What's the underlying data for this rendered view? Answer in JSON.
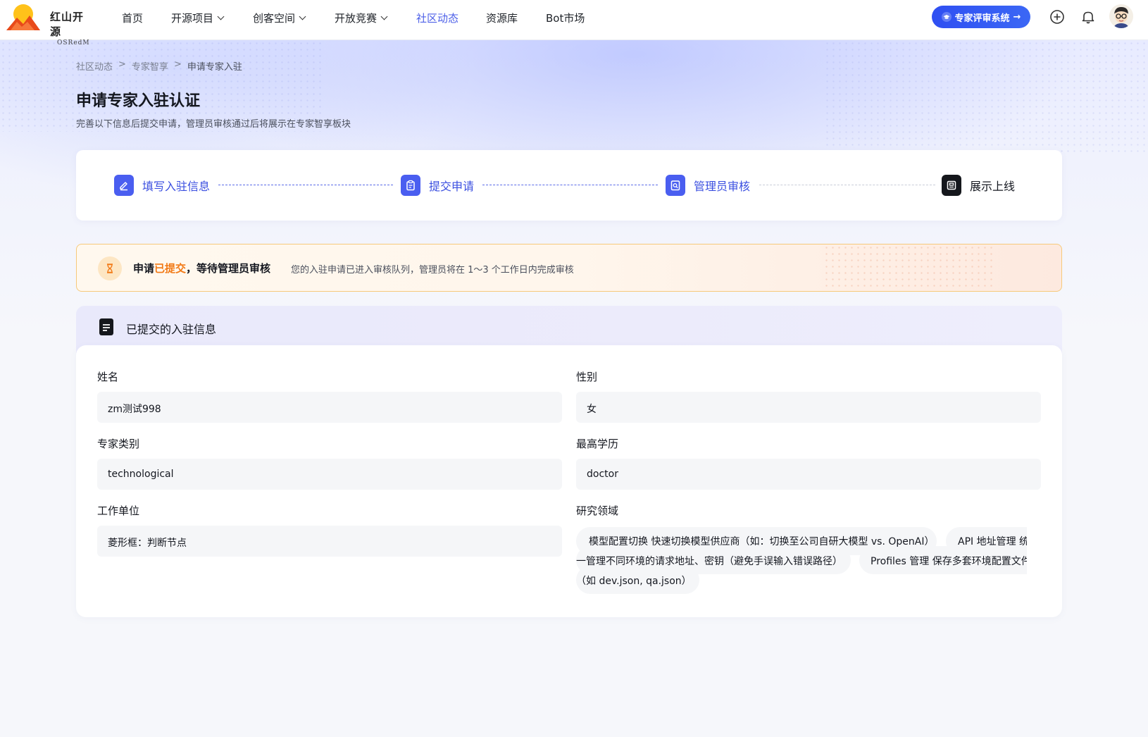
{
  "header": {
    "logo_cn": "红山开源",
    "logo_en": "OSRedM",
    "nav": [
      {
        "label": "首页",
        "dropdown": false
      },
      {
        "label": "开源项目",
        "dropdown": true
      },
      {
        "label": "创客空间",
        "dropdown": true
      },
      {
        "label": "开放竞赛",
        "dropdown": true
      },
      {
        "label": "社区动态",
        "dropdown": false,
        "active": true
      },
      {
        "label": "资源库",
        "dropdown": false
      },
      {
        "label": "Bot市场",
        "dropdown": false
      }
    ],
    "expert_button": "专家评审系统",
    "icons": [
      "plus-circle-icon",
      "bell-icon",
      "avatar"
    ]
  },
  "breadcrumb": [
    "社区动态",
    "专家智享",
    "申请专家入驻"
  ],
  "page": {
    "title": "申请专家入驻认证",
    "subtitle": "完善以下信息后提交申请，管理员审核通过后将展示在专家智享板块"
  },
  "steps": [
    {
      "label": "填写入驻信息",
      "icon": "edit-icon",
      "state": "done"
    },
    {
      "label": "提交申请",
      "icon": "clipboard-icon",
      "state": "done"
    },
    {
      "label": "管理员审核",
      "icon": "review-icon",
      "state": "current"
    },
    {
      "label": "展示上线",
      "icon": "display-icon",
      "state": "pending"
    }
  ],
  "notice": {
    "icon": "hourglass-icon",
    "title_prefix": "申请",
    "title_highlight": "已提交",
    "title_suffix": "，等待管理员审核",
    "description": "您的入驻申请已进入审核队列，管理员将在 1～3 个工作日内完成审核",
    "accent": "#f27a16"
  },
  "info": {
    "section_title": "已提交的入驻信息",
    "fields": {
      "name": {
        "label": "姓名",
        "value": "zm测试998"
      },
      "gender": {
        "label": "性别",
        "value": "女"
      },
      "category": {
        "label": "专家类别",
        "value": "technological"
      },
      "education": {
        "label": "最高学历",
        "value": "doctor"
      },
      "organization": {
        "label": "工作单位",
        "value": "菱形框：判断节点"
      },
      "research": {
        "label": "研究领域",
        "tags_text": [
          "模型配置切换 快速切换模型供应商（如：切换至公司自研大模型 vs. OpenAI）",
          "API 地址管理 统",
          "一管理不同环境的请求地址、密钥（避免手误输入错误路径）",
          "Profiles 管理 保存多套环境配置文件",
          "（如 dev.json, qa.json）"
        ]
      }
    }
  },
  "colors": {
    "primary": "#4a5ef0",
    "nav_active": "#4c5fe8",
    "button_gradient_start": "#2f4ff2",
    "warning_border": "#f6c97a"
  }
}
